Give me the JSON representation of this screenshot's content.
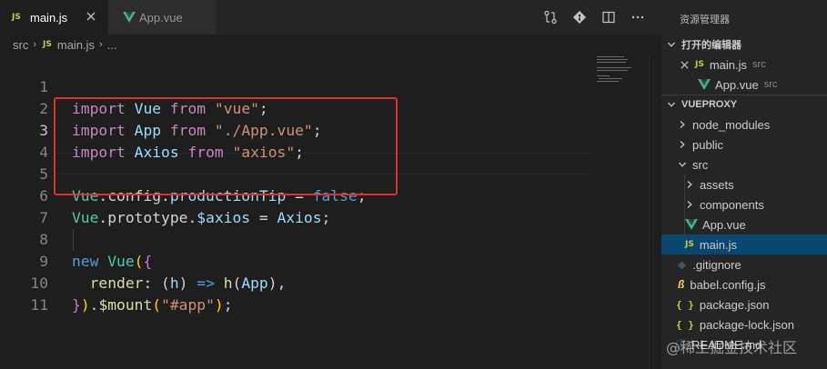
{
  "tabs": [
    {
      "badge": "JS",
      "label": "main.js",
      "active": true
    },
    {
      "label": "App.vue",
      "active": false
    }
  ],
  "breadcrumb": {
    "folder": "src",
    "badge": "JS",
    "file": "main.js",
    "tail": "..."
  },
  "code_lines": [
    {
      "n": "1"
    },
    {
      "n": "2"
    },
    {
      "n": "3"
    },
    {
      "n": "4"
    },
    {
      "n": "5"
    },
    {
      "n": "6"
    },
    {
      "n": "7"
    },
    {
      "n": "8"
    },
    {
      "n": "9"
    },
    {
      "n": "10"
    },
    {
      "n": "11"
    }
  ],
  "code": {
    "l1": {
      "kw": "import",
      "cls": "Vue",
      "kw2": "from",
      "str": "\"vue\"",
      "end": ";"
    },
    "l2": {
      "kw": "import",
      "cls": "App",
      "kw2": "from",
      "str": "\"./App.vue\"",
      "end": ";"
    },
    "l3": {
      "kw": "import",
      "cls": "Axios",
      "kw2": "from",
      "str": "\"axios\"",
      "end": ";"
    },
    "l5": {
      "cls": "Vue",
      "p1": ".config.",
      "prop": "productionTip",
      "op": " = ",
      "bool": "false",
      "end": ";"
    },
    "l6": {
      "cls": "Vue",
      "p1": ".prototype.",
      "prop": "$axios",
      "op": " = ",
      "cls2": "Axios",
      "end": ";"
    },
    "l8": {
      "kw": "new",
      "cls": "Vue",
      "open": "(",
      "brace": "{"
    },
    "l9": {
      "prop": "render",
      "colon": ": ",
      "open": "(",
      "arg": "h",
      "close": ")",
      "arrow": " => ",
      "fn": "h",
      "o2": "(",
      "arg2": "App",
      "c2": ")",
      "comma": ","
    },
    "l10": {
      "brace": "}",
      "close": ")",
      "dot": ".",
      "fn": "$mount",
      "o": "(",
      "str": "\"#app\"",
      "c": ")",
      "end": ";"
    }
  },
  "explorer": {
    "title": "资源管理器",
    "open_editors_label": "打开的编辑器",
    "open_editors": [
      {
        "badge": "JS",
        "name": "main.js",
        "hint": "src"
      },
      {
        "name": "App.vue",
        "hint": "src"
      }
    ],
    "project_label": "VUEPROXY",
    "tree": [
      {
        "name": "node_modules"
      },
      {
        "name": "public"
      },
      {
        "name": "src"
      },
      {
        "name": "assets"
      },
      {
        "name": "components"
      },
      {
        "name": "App.vue"
      },
      {
        "badge": "JS",
        "name": "main.js"
      },
      {
        "name": ".gitignore"
      },
      {
        "name": "babel.config.js"
      },
      {
        "icon": "{ }",
        "name": "package.json"
      },
      {
        "icon": "{ }",
        "name": "package-lock.json"
      },
      {
        "name": "README.md"
      }
    ]
  },
  "watermark": "@稀土掘金技术社区",
  "colors": {
    "accent": "#e0302a",
    "selection": "#094771",
    "keyword": "#c586c0",
    "string": "#ce9178",
    "class": "#4ec9b0"
  }
}
